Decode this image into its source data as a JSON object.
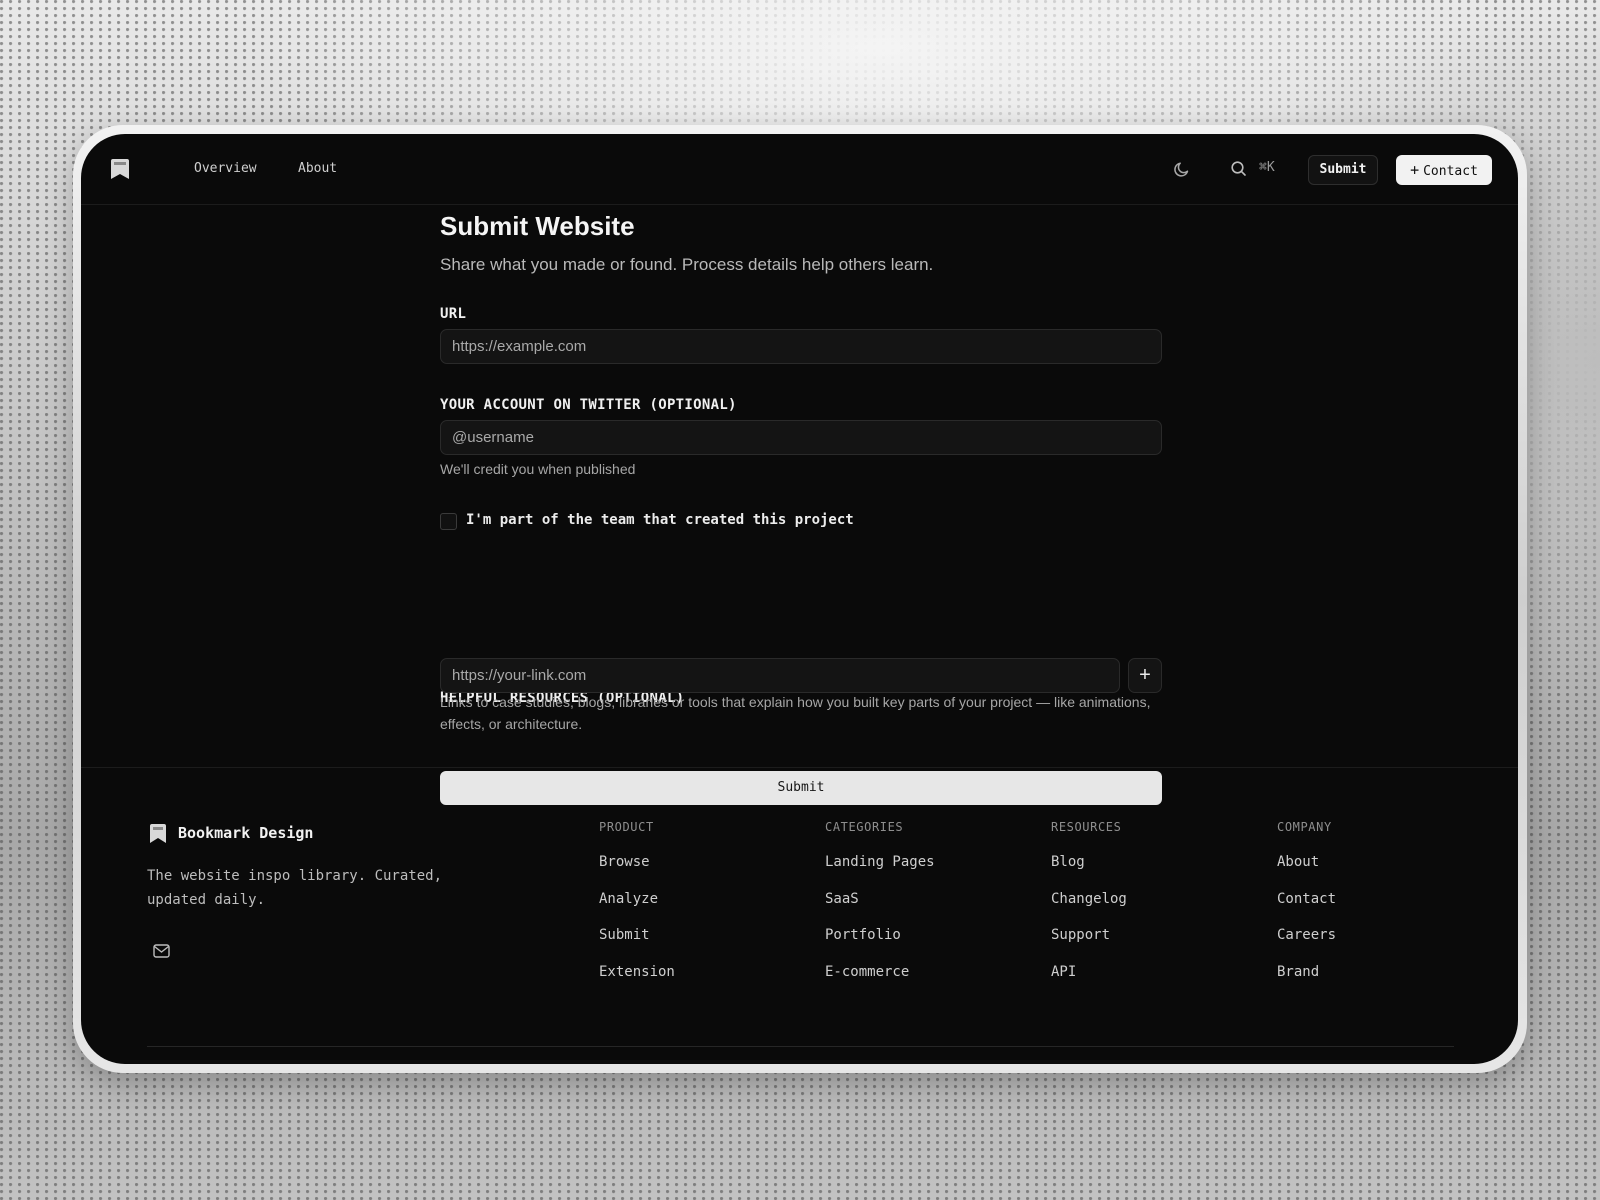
{
  "nav": {
    "links": [
      "Overview",
      "About"
    ],
    "theme_icon": "moon-icon",
    "search_icon": "search-icon",
    "search_shortcut": "⌘K",
    "submit_label": "Submit",
    "contact_label": "Contact"
  },
  "form": {
    "title": "Submit Website",
    "subtitle": "Share what you made or found. Process details help others learn.",
    "url_label": "URL",
    "url_placeholder": "https://example.com",
    "twitter_label": "YOUR ACCOUNT ON TWITTER (OPTIONAL)",
    "twitter_placeholder": "@username",
    "twitter_hint": "We'll credit you when published",
    "team_checkbox_label": "I'm part of the team that created this project",
    "team_checkbox_checked": false,
    "resources_label": "HELPFUL RESOURCES (OPTIONAL)",
    "resources_placeholder": "https://your-link.com",
    "resources_add": "+",
    "resources_hint": "Links to case studies, blogs, libraries or tools that explain how you built key parts of your project — like animations, effects, or architecture.",
    "submit_label": "Submit"
  },
  "footer": {
    "brand": "Bookmark Design",
    "tagline": "The website inspo library. Curated, updated daily.",
    "mail_icon": "mail-icon",
    "columns": [
      {
        "title": "PRODUCT",
        "links": [
          "Browse",
          "Analyze",
          "Submit",
          "Extension"
        ]
      },
      {
        "title": "CATEGORIES",
        "links": [
          "Landing Pages",
          "SaaS",
          "Portfolio",
          "E-commerce"
        ]
      },
      {
        "title": "RESOURCES",
        "links": [
          "Blog",
          "Changelog",
          "Support",
          "API"
        ]
      },
      {
        "title": "COMPANY",
        "links": [
          "About",
          "Contact",
          "Careers",
          "Brand"
        ]
      }
    ]
  },
  "colors": {
    "screen_bg": "#0a0a0a",
    "input_bg": "#141414",
    "primary_button": "#e7e7e7",
    "text": "#e8e8e8"
  }
}
